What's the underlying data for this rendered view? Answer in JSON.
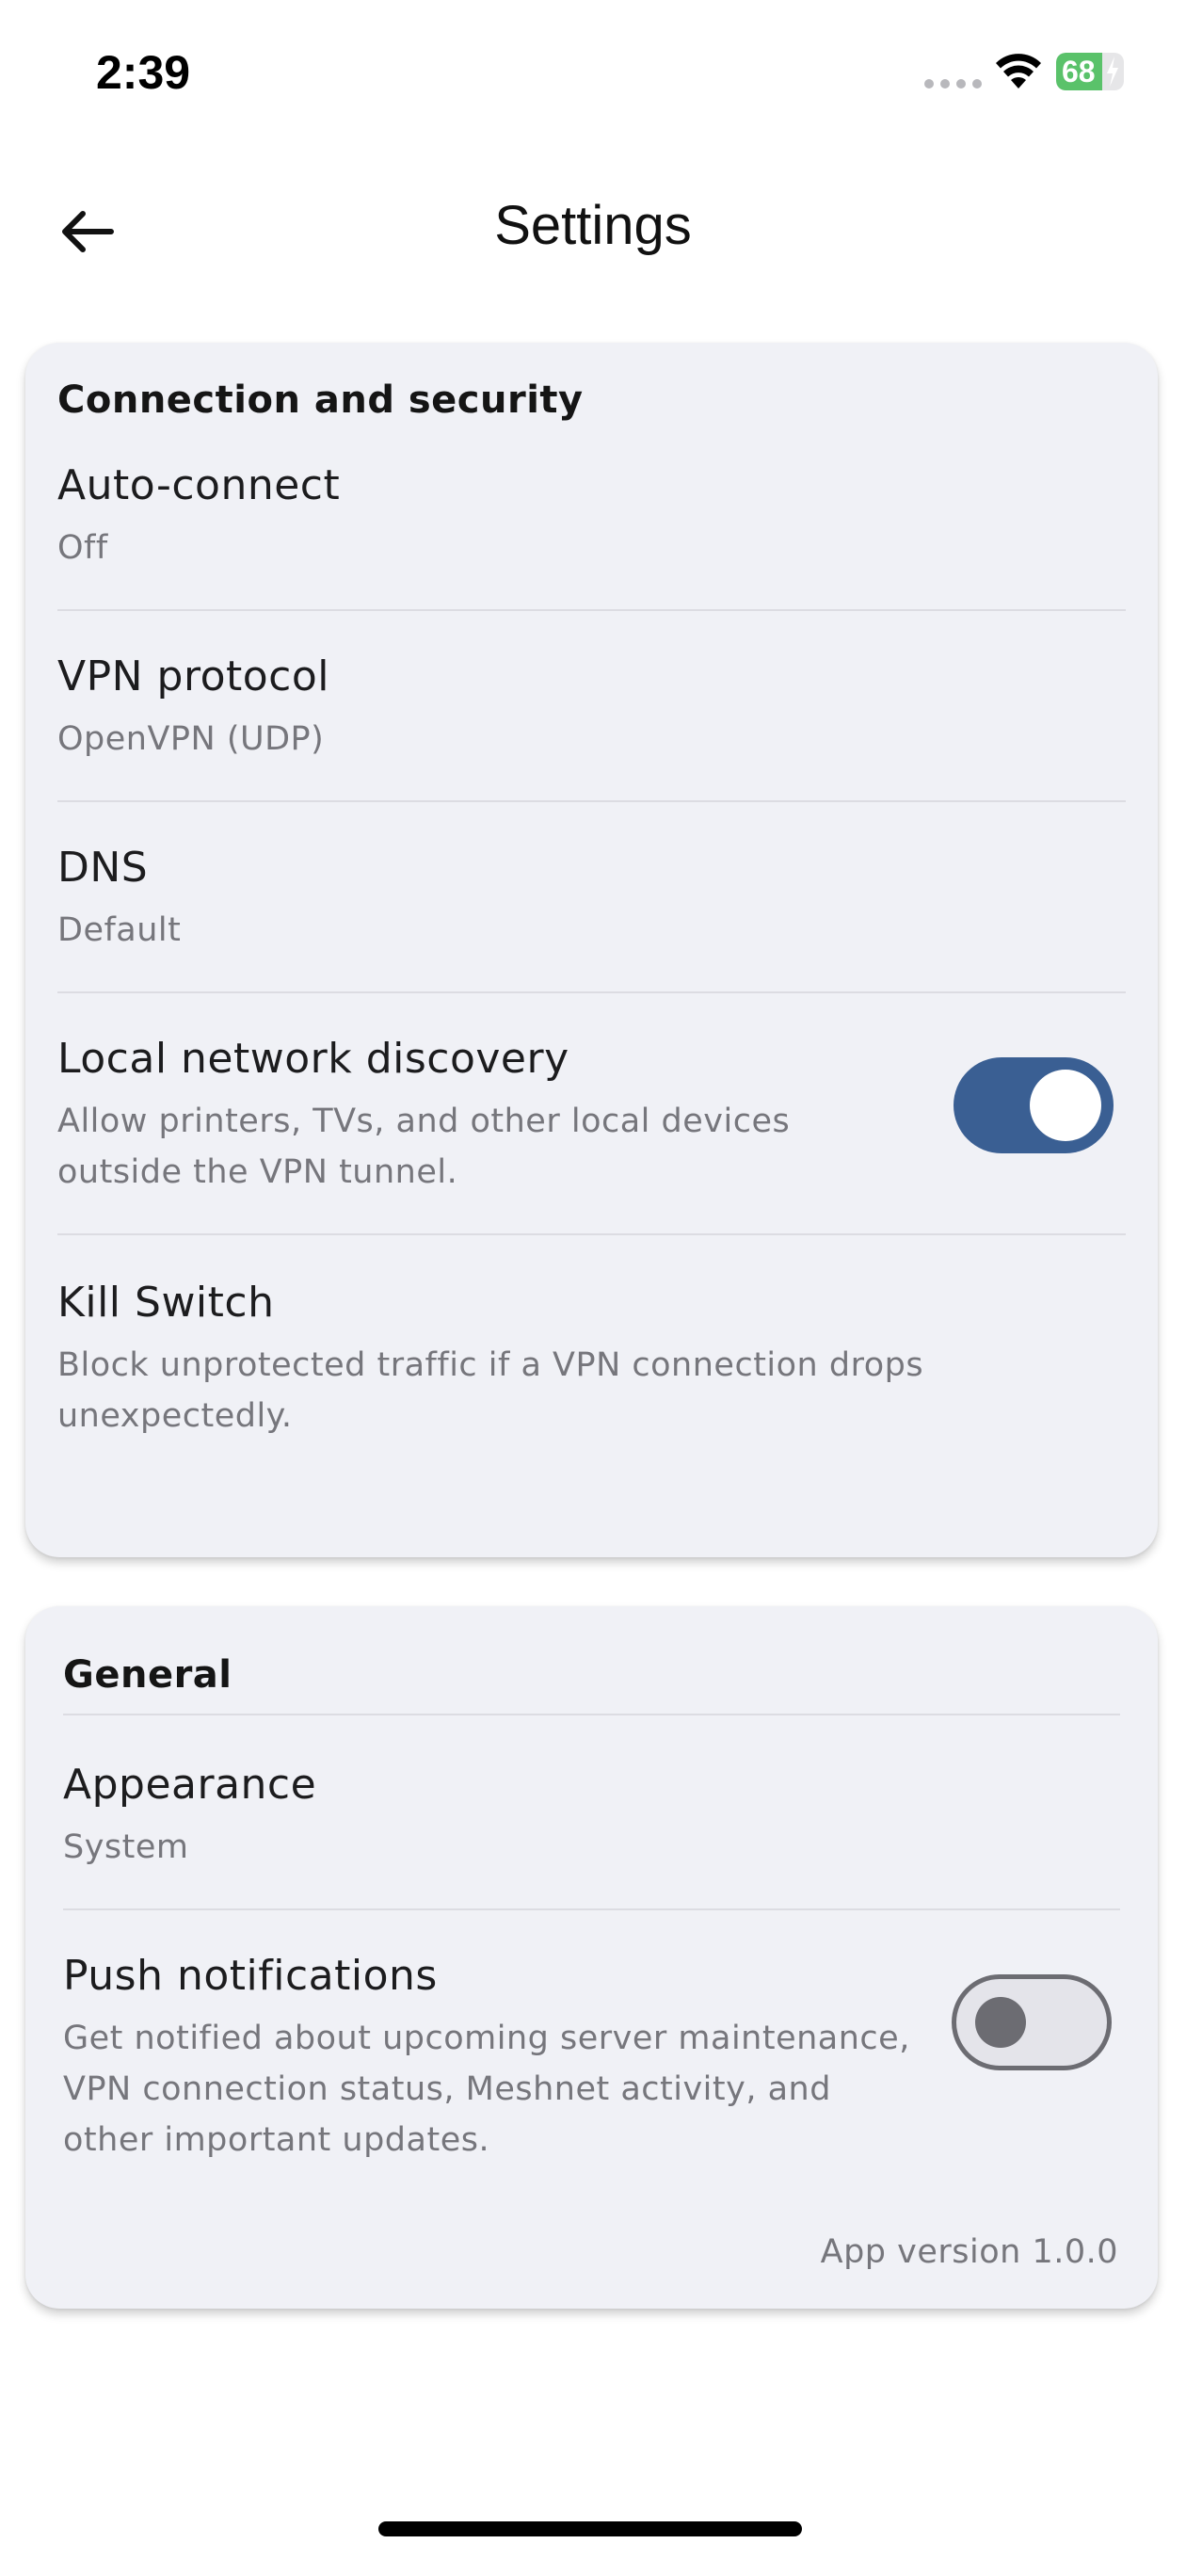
{
  "status_bar": {
    "time": "2:39",
    "battery_percent": "68",
    "battery_level": 0.68
  },
  "header": {
    "title": "Settings",
    "back_icon": "arrow-left-icon"
  },
  "sections": [
    {
      "title": "Connection and security",
      "items": [
        {
          "title": "Auto-connect",
          "subtitle": "Off"
        },
        {
          "title": "VPN protocol",
          "subtitle": "OpenVPN (UDP)"
        },
        {
          "title": "DNS",
          "subtitle": "Default"
        },
        {
          "title": "Local network discovery",
          "subtitle": "Allow printers, TVs, and other local devices outside the VPN tunnel.",
          "toggle": true
        },
        {
          "title": "Kill Switch",
          "subtitle": "Block unprotected traffic if a VPN connection drops unexpectedly."
        }
      ]
    },
    {
      "title": "General",
      "items": [
        {
          "title": "Appearance",
          "subtitle": "System"
        },
        {
          "title": "Push notifications",
          "subtitle": "Get notified about upcoming server maintenance, VPN connection status, Meshnet activity, and other important updates.",
          "toggle": false
        }
      ]
    }
  ],
  "app_version": "App version 1.0.0",
  "colors": {
    "accent": "#3a5f93",
    "card_background": "#f0f1f6",
    "battery_green": "#5ac26a"
  }
}
